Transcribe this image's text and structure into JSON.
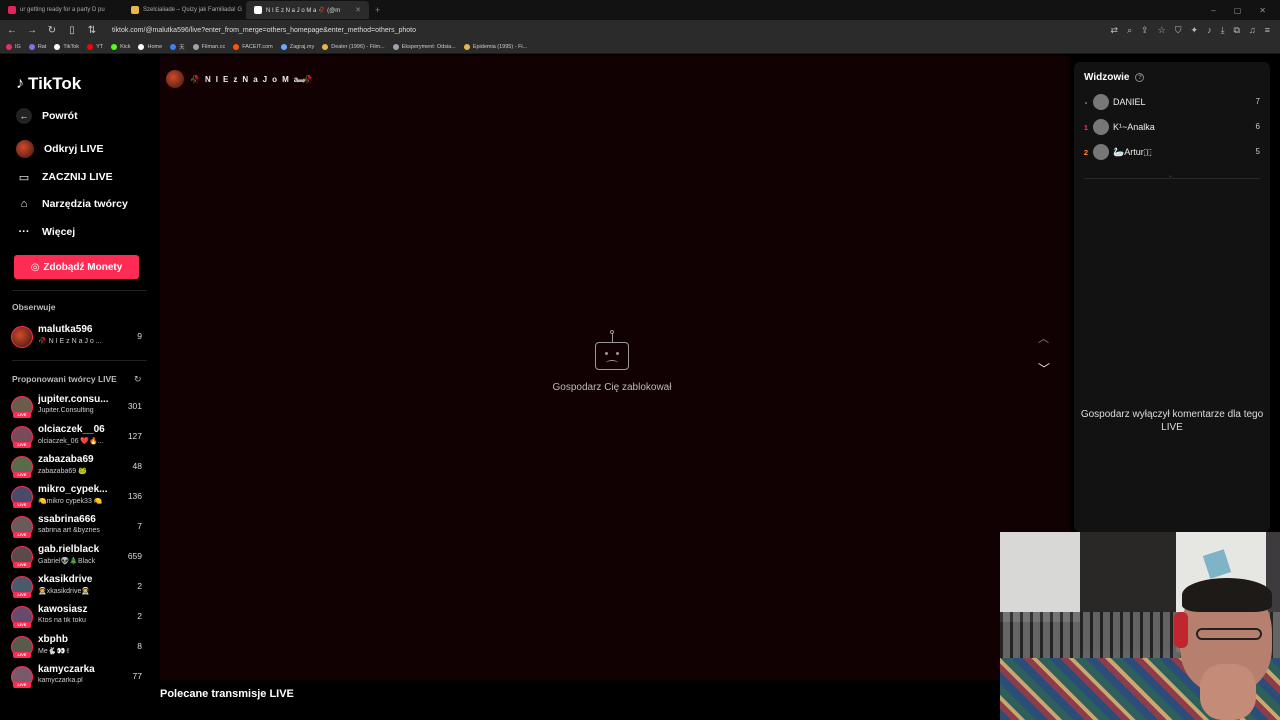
{
  "browser": {
    "tabs": [
      {
        "label": "ur getting ready for a party D pu",
        "color": "#e0245e",
        "active": false
      },
      {
        "label": "Szelcialiade – Quizy jak Familiada! G",
        "color": "#e8b64a",
        "active": false
      },
      {
        "label": "N I E z N a J o M a 🥀 (@m",
        "color": "#ffffff",
        "active": true
      }
    ],
    "url": "tiktok.com/@malutka596/live?enter_from_merge=others_homepage&enter_method=others_photo",
    "bookmarks": [
      {
        "label": "IG",
        "color": "#e1306c"
      },
      {
        "label": "Rat",
        "color": "#8a6de9"
      },
      {
        "label": "TikTok",
        "color": "#ffffff"
      },
      {
        "label": "YT",
        "color": "#ff0000"
      },
      {
        "label": "Kick",
        "color": "#53fc18"
      },
      {
        "label": "Home",
        "color": "#ffffff"
      },
      {
        "label": "天",
        "color": "#3b82f6"
      },
      {
        "label": "Filman.cc",
        "color": "#9ca3af"
      },
      {
        "label": "FACEIT.com",
        "color": "#ff5500"
      },
      {
        "label": "Zagraj.my",
        "color": "#6aa9ff"
      },
      {
        "label": "Dealer (1996) - Film...",
        "color": "#e8b64a"
      },
      {
        "label": "Eksperyment: Odsia...",
        "color": "#9ca3af"
      },
      {
        "label": "Epidemia (1995) - Fi...",
        "color": "#e8b64a"
      }
    ]
  },
  "sidebar": {
    "logo": "TikTok",
    "back": "Powrót",
    "menu": [
      "Odkryj LIVE",
      "ZACZNIJ LIVE",
      "Narzędzia twórcy",
      "Więcej"
    ],
    "coins_button": "Zdobądź Monety",
    "following_title": "Obserwuje",
    "following": [
      {
        "name": "malutka596",
        "sub": "🥀 N I E z N a J o ...",
        "count": "9"
      }
    ],
    "suggested_title": "Proponowani twórcy LIVE",
    "live_badge": "LIVE",
    "suggested": [
      {
        "name": "jupiter.consu...",
        "sub": "Jupiter.Consulting",
        "count": "301"
      },
      {
        "name": "olciaczek__06",
        "sub": "olciaczek_06 ❤️🔥...",
        "count": "127"
      },
      {
        "name": "zabazaba69",
        "sub": "zabazaba69 🐸",
        "count": "48"
      },
      {
        "name": "mikro_cypek...",
        "sub": "🍋mikro cypek33 🍋",
        "count": "136"
      },
      {
        "name": "ssabrina666",
        "sub": "sabrina art &byznes",
        "count": "7"
      },
      {
        "name": "gab.rielblack",
        "sub": "Gabriel👽🎄Black",
        "count": "659"
      },
      {
        "name": "xkasikdrive",
        "sub": "👨‍🚀xkasikdrive👨‍🚀",
        "count": "2"
      },
      {
        "name": "kawosiasz",
        "sub": "Ktoś na tik toku",
        "count": "2"
      },
      {
        "name": "xbphb",
        "sub": "Me🐇👀✌",
        "count": "8"
      },
      {
        "name": "kamyczarka",
        "sub": "kamyczarka.pl",
        "count": "77"
      }
    ]
  },
  "stage": {
    "host_name": "🥀 N I E z N a J o M a 🥀",
    "blocked_message": "Gospodarz Cię zablokował",
    "bottom_section": "Polecane transmisje LIVE"
  },
  "viewers": {
    "title": "Widzowie",
    "list": [
      {
        "rank": "-",
        "name": "DANIEL",
        "score": "7",
        "rank_color": "#bbbbbb"
      },
      {
        "rank": "1",
        "name": "K¹~Analka",
        "score": "6",
        "rank_color": "#fe2c55"
      },
      {
        "rank": "2",
        "name": "🦢Artur🇮",
        "score": "5",
        "rank_color": "#ff8a3d"
      }
    ],
    "comments_off": "Gospodarz wyłączył komentarze dla tego LIVE"
  },
  "colors": {
    "accent": "#fe2c55",
    "stage_bg": "#120103"
  }
}
